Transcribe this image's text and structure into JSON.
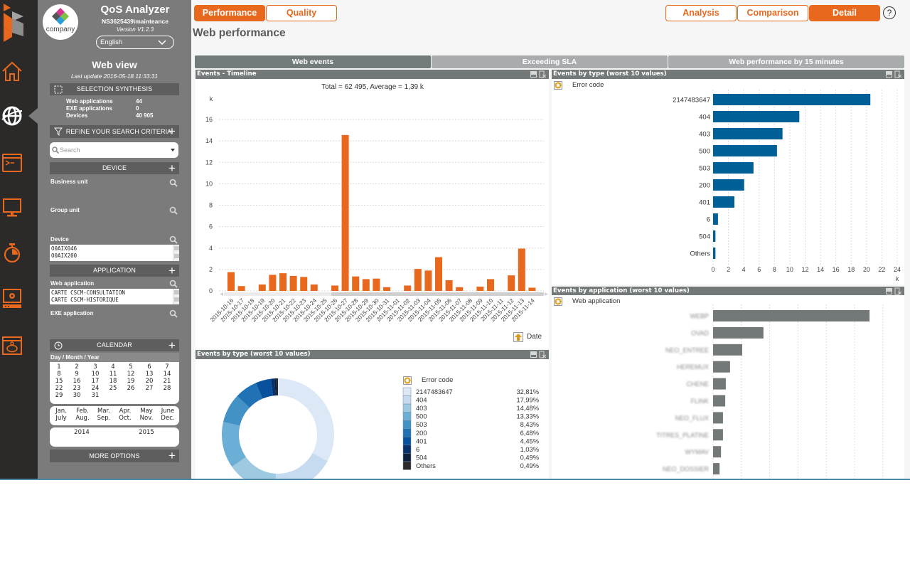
{
  "nav": {
    "items": [
      {
        "id": "brand",
        "icon": "brand-logo-icon"
      },
      {
        "id": "home",
        "icon": "home-icon"
      },
      {
        "id": "web",
        "icon": "globe-icon",
        "selected": true
      },
      {
        "id": "exe",
        "icon": "terminal-window-icon"
      },
      {
        "id": "device",
        "icon": "monitor-icon"
      },
      {
        "id": "performance",
        "icon": "stopwatch-icon"
      },
      {
        "id": "settings",
        "icon": "gear-screen-icon"
      },
      {
        "id": "cost",
        "icon": "piggy-bank-window-icon"
      }
    ]
  },
  "sidebar": {
    "logo_text": "company",
    "app_title": "QoS Analyzer",
    "user": "NS3625439\\mainteance",
    "version": "Version V1.2.3",
    "language": "English",
    "view_title": "Web view",
    "last_update": "Last update 2016-05-18 11:33:31",
    "synthesis": {
      "title": "SELECTION SYNTHESIS",
      "rows": [
        {
          "label": "Web applications",
          "value": "44"
        },
        {
          "label": "EXE applications",
          "value": "0"
        },
        {
          "label": "Devices",
          "value": "40 905"
        }
      ]
    },
    "refine": {
      "title": "REFINE YOUR SEARCH CRITERIA",
      "search_placeholder": "Search"
    },
    "device": {
      "title": "DEVICE",
      "business_unit": "Business unit",
      "group_unit": "Group unit",
      "device_label": "Device",
      "device_list": [
        "O0AIX046",
        "O0AIX200"
      ]
    },
    "application": {
      "title": "APPLICATION",
      "web_label": "Web application",
      "web_list": [
        "CARTE CSCM-CONSULTATION",
        "CARTE CSCM-HISTORIQUE"
      ],
      "exe_label": "EXE application"
    },
    "calendar": {
      "title": "CALENDAR",
      "subtitle": "Day / Month / Year",
      "days": [
        "1",
        "2",
        "3",
        "4",
        "5",
        "6",
        "7",
        "8",
        "9",
        "10",
        "11",
        "12",
        "13",
        "14",
        "15",
        "16",
        "17",
        "18",
        "19",
        "20",
        "21",
        "22",
        "23",
        "24",
        "25",
        "26",
        "27",
        "28",
        "29",
        "30",
        "31"
      ],
      "months": [
        "Jan.",
        "Feb.",
        "Mar.",
        "Apr.",
        "May",
        "June",
        "July",
        "Aug.",
        "Sep.",
        "Oct.",
        "Nov.",
        "Dec."
      ],
      "years": [
        "2014",
        "2015"
      ]
    },
    "more_options": "MORE OPTIONS"
  },
  "header": {
    "left_buttons": [
      {
        "label": "Performance",
        "active": true
      },
      {
        "label": "Quality",
        "active": false
      }
    ],
    "right_buttons": [
      {
        "label": "Analysis",
        "active": false
      },
      {
        "label": "Comparison",
        "active": false
      },
      {
        "label": "Detail",
        "active": true
      }
    ],
    "help": "?"
  },
  "page_title": "Web performance",
  "tabs": [
    {
      "label": "Web events",
      "active": true
    },
    {
      "label": "Exceeding SLA",
      "active": false
    },
    {
      "label": "Web performance by 15 minutes",
      "active": false
    }
  ],
  "panels": {
    "timeline": {
      "title": "Events - Timeline",
      "x_dimension": "Date"
    },
    "type_bar": {
      "title": "Events by type (worst 10 values)",
      "dimension": "Error code"
    },
    "app_bar": {
      "title": "Events by application (worst 10 values)",
      "dimension": "Web application"
    },
    "type_donut": {
      "title": "Events by type (worst 10 values)",
      "dimension": "Error code"
    }
  },
  "colors": {
    "accent": "#e8681e",
    "bar_blue": "#005f96",
    "bar_gray": "#737879",
    "panel_header": "#737879"
  },
  "chart_data": [
    {
      "id": "timeline",
      "type": "bar",
      "title": "Total = 62 495, Average = 1,39 k",
      "xlabel": "Date",
      "ylabel": "k",
      "ylim": [
        0,
        16
      ],
      "yticks": [
        0,
        2,
        4,
        6,
        8,
        10,
        12,
        14,
        16
      ],
      "grid": true,
      "color": "#e8681e",
      "categories": [
        "2015-10-16",
        "2015-10-17",
        "2015-10-18",
        "2015-10-19",
        "2015-10-20",
        "2015-10-21",
        "2015-10-22",
        "2015-10-23",
        "2015-10-24",
        "2015-10-25",
        "2015-10-26",
        "2015-10-27",
        "2015-10-28",
        "2015-10-29",
        "2015-10-30",
        "2015-10-31",
        "2015-11-01",
        "2015-11-02",
        "2015-11-03",
        "2015-11-04",
        "2015-11-05",
        "2015-11-06",
        "2015-11-07",
        "2015-11-08",
        "2015-11-09",
        "2015-11-10",
        "2015-11-11",
        "2015-11-12",
        "2015-11-13",
        "2015-11-14"
      ],
      "values": [
        1.75,
        0.45,
        0,
        0.6,
        1.5,
        1.65,
        1.4,
        1.3,
        0.6,
        0,
        0.5,
        14.55,
        1.35,
        1.1,
        1.15,
        0.35,
        0,
        0.5,
        2.05,
        1.9,
        3.15,
        1.0,
        0.35,
        0,
        0.4,
        1.1,
        0,
        1.45,
        3.95,
        0.3
      ]
    },
    {
      "id": "type_bar",
      "type": "bar",
      "orientation": "horizontal",
      "title": "Events by type (worst 10 values)",
      "ylabel": "Error code",
      "xlabel": "k",
      "xlim": [
        0,
        24
      ],
      "xticks": [
        0,
        2,
        4,
        6,
        8,
        10,
        12,
        14,
        16,
        18,
        20,
        22,
        24
      ],
      "grid": true,
      "color": "#005f96",
      "categories": [
        "2147483647",
        "404",
        "403",
        "500",
        "503",
        "200",
        "401",
        "6",
        "504",
        "Others"
      ],
      "values": [
        20.5,
        11.24,
        9.05,
        8.33,
        5.27,
        4.05,
        2.78,
        0.64,
        0.31,
        0.31
      ]
    },
    {
      "id": "app_bar",
      "type": "bar",
      "orientation": "horizontal",
      "title": "Events by application (worst 10 values)",
      "ylabel": "Web application",
      "xlim": [
        0,
        6
      ],
      "grid": true,
      "axis_labels_visible": false,
      "labels_blurred": true,
      "color": "#737879",
      "categories": [
        "WEBP",
        "OVAD",
        "NEO_ENTREE",
        "HEREMUX",
        "CHENE",
        "FLINK",
        "NEO_FLUX",
        "TITRES_PLATINE",
        "WYMAV",
        "NEO_DOSSIER"
      ],
      "values": [
        5.53,
        1.78,
        1.03,
        0.6,
        0.45,
        0.43,
        0.35,
        0.35,
        0.28,
        0.23
      ]
    },
    {
      "id": "type_donut",
      "type": "pie",
      "donut": true,
      "title": "Events by type (worst 10 values)",
      "legend_title": "Error code",
      "legend": "right",
      "categories": [
        "2147483647",
        "404",
        "403",
        "500",
        "503",
        "200",
        "401",
        "6",
        "504",
        "Others"
      ],
      "values": [
        32.81,
        17.99,
        14.48,
        13.33,
        8.43,
        6.48,
        4.45,
        1.03,
        0.49,
        0.49
      ],
      "labels": [
        "32,81%",
        "17,99%",
        "14,48%",
        "13,33%",
        "8,43%",
        "6,48%",
        "4,45%",
        "1,03%",
        "0,49%",
        "0,49%"
      ],
      "colors": [
        "#dce8f5",
        "#c6dbef",
        "#9ecae1",
        "#6baed6",
        "#4292c6",
        "#2171b5",
        "#08519c",
        "#08306b",
        "#0c1f3d",
        "#2b2b2b"
      ]
    }
  ]
}
